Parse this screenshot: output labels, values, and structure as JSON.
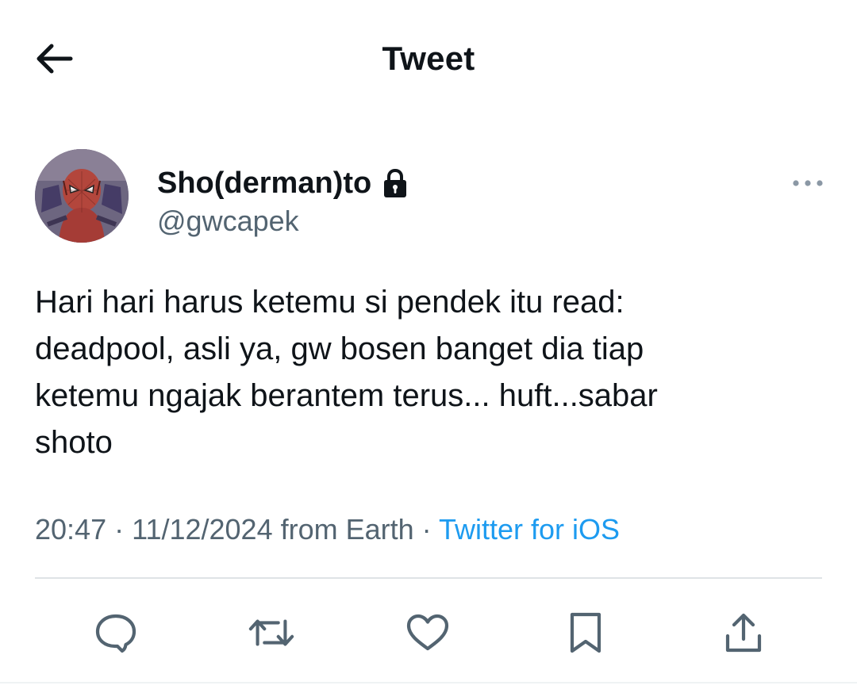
{
  "header": {
    "title": "Tweet",
    "back_icon": "arrow-left-icon"
  },
  "author": {
    "display_name": "Sho(derman)to",
    "handle": "@gwcapek",
    "protected_icon": "lock-icon",
    "avatar": "avatar-image",
    "more_icon": "more-horizontal-icon"
  },
  "tweet": {
    "text": "Hari hari harus ketemu si pendek itu read:\ndeadpool, asli ya, gw bosen banget dia tiap\nketemu ngajak berantem terus... huft...sabar\nshoto",
    "time": "20:47",
    "separator_1": " · ",
    "date": "11/12/2024",
    "location": " from Earth",
    "separator_2": " · ",
    "source": "Twitter for iOS"
  },
  "actions": [
    {
      "name": "reply",
      "icon": "reply-icon"
    },
    {
      "name": "retweet",
      "icon": "retweet-icon"
    },
    {
      "name": "like",
      "icon": "heart-icon"
    },
    {
      "name": "bookmark",
      "icon": "bookmark-icon"
    },
    {
      "name": "share",
      "icon": "share-icon"
    }
  ],
  "colors": {
    "text_primary": "#0f1419",
    "text_secondary": "#536471",
    "link": "#1d9bf0",
    "divider": "#dfe3e6"
  }
}
